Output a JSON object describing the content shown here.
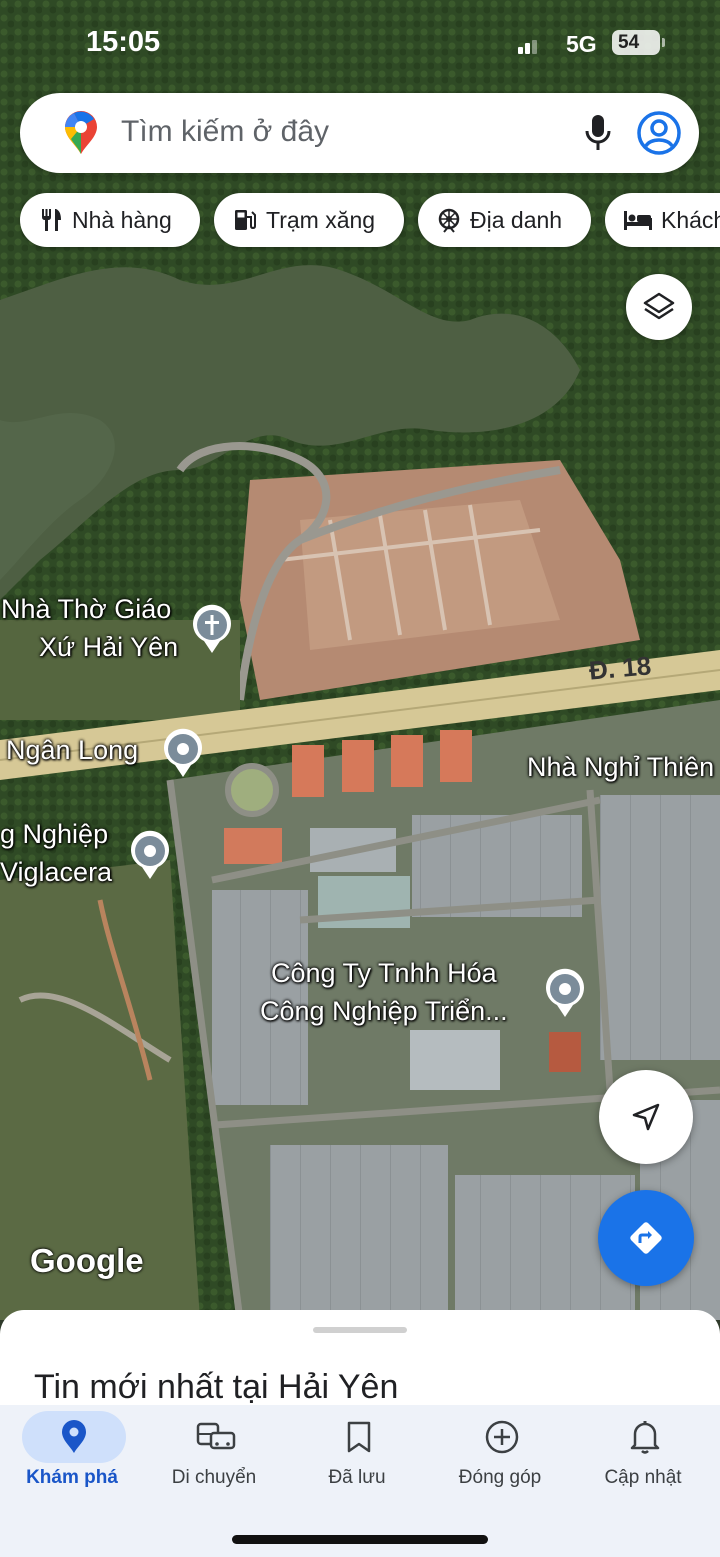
{
  "status_bar": {
    "time": "15:05",
    "network": "5G",
    "battery": "54"
  },
  "search": {
    "placeholder": "Tìm kiếm ở đây"
  },
  "chips": [
    {
      "label": "Nhà hàng",
      "icon": "restaurant-icon"
    },
    {
      "label": "Trạm xăng",
      "icon": "gas-station-icon"
    },
    {
      "label": "Địa danh",
      "icon": "landmark-icon"
    },
    {
      "label": "Khách",
      "icon": "hotel-icon"
    }
  ],
  "map": {
    "pois": [
      {
        "line1": "Nhà Thờ Giáo",
        "line2": "Xứ Hải Yên",
        "icon": "church-icon"
      },
      {
        "line1": "Ngân Long",
        "icon": "place-pin-icon"
      },
      {
        "line1": "g Nghiệp",
        "line2": "Viglacera",
        "icon": "place-pin-icon"
      },
      {
        "line1": "Công Ty Tnhh Hóa",
        "line2": "Công Nghiệp Triển...",
        "icon": "place-pin-icon"
      },
      {
        "line1": "Nhà Nghỉ Thiên"
      }
    ],
    "road_label": "Đ. 18",
    "attribution": "Google"
  },
  "sheet": {
    "headline": "Tin mới nhất tại Hải Yên"
  },
  "bottom_nav": [
    {
      "label": "Khám phá",
      "icon": "explore-pin-icon",
      "active": true
    },
    {
      "label": "Di chuyển",
      "icon": "commute-icon",
      "active": false
    },
    {
      "label": "Đã lưu",
      "icon": "bookmark-icon",
      "active": false
    },
    {
      "label": "Đóng góp",
      "icon": "add-circle-icon",
      "active": false
    },
    {
      "label": "Cập nhật",
      "icon": "bell-icon",
      "active": false
    }
  ],
  "colors": {
    "accent": "#1a73e8",
    "nav_bg": "#eef2f9",
    "active_pill": "#cfe0fb"
  }
}
